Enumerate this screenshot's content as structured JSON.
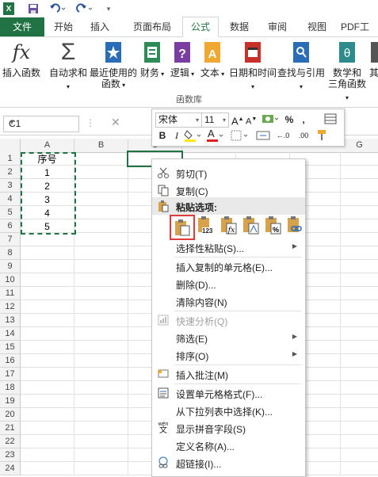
{
  "qat": {
    "app_icon": "excel-icon",
    "save_icon": "save-icon",
    "undo_icon": "undo-icon",
    "redo_icon": "redo-icon"
  },
  "tabs": [
    "文件",
    "开始",
    "插入",
    "页面布局",
    "公式",
    "数据",
    "审阅",
    "视图",
    "PDF工具"
  ],
  "ribbon": {
    "buttons": [
      {
        "label": "插入函数",
        "icon": "fx-icon"
      },
      {
        "label": "自动求和",
        "icon": "sigma-icon"
      },
      {
        "label": "最近使用的",
        "label2": "函数",
        "icon": "star-book-icon"
      },
      {
        "label": "财务",
        "icon": "finance-book-icon"
      },
      {
        "label": "逻辑",
        "icon": "logic-book-icon"
      },
      {
        "label": "文本",
        "icon": "text-book-icon"
      },
      {
        "label": "日期和时间",
        "icon": "calendar-book-icon"
      },
      {
        "label": "查找与引用",
        "icon": "lookup-book-icon"
      },
      {
        "label": "数学和",
        "label2": "三角函数",
        "icon": "math-book-icon"
      },
      {
        "label": "其",
        "icon": "more-book-icon"
      }
    ],
    "group_label": "函数库"
  },
  "namebox": {
    "value": "C1"
  },
  "columns": [
    "A",
    "B",
    "C",
    "G"
  ],
  "rows": [
    "1",
    "2",
    "3",
    "4",
    "5",
    "6",
    "7",
    "8",
    "9",
    "10",
    "11",
    "12",
    "13",
    "14",
    "15",
    "16",
    "17",
    "18",
    "19",
    "20",
    "21",
    "22",
    "23",
    "24"
  ],
  "cells": {
    "a1": "序号",
    "a2": "1",
    "a3": "2",
    "a4": "3",
    "a5": "4",
    "a6": "5"
  },
  "mini_toolbar": {
    "font": "宋体",
    "size": "11",
    "grow": "A",
    "shrink": "A",
    "percent": "%",
    "comma": ",",
    "bold": "B",
    "italic": "I",
    "font_color_letter": "A",
    "dec_inc": "←.0",
    "dec_dec": ".00"
  },
  "context_menu": {
    "cut": "剪切(T)",
    "copy": "复制(C)",
    "paste_options": "粘贴选项:",
    "paste_special": "选择性粘贴(S)...",
    "insert_copied": "插入复制的单元格(E)...",
    "delete": "删除(D)...",
    "clear": "清除内容(N)",
    "quick_analysis": "快速分析(Q)",
    "filter": "筛选(E)",
    "sort": "排序(O)",
    "insert_comment": "插入批注(M)",
    "format_cells": "设置单元格格式(F)...",
    "pick_list": "从下拉列表中选择(K)...",
    "phonetic": "显示拼音字段(S)",
    "define_name": "定义名称(A)...",
    "hyperlink": "超链接(I)...",
    "phonetic_icon_text": "wén",
    "phonetic_icon_char": "文",
    "paste_123": "123"
  },
  "colors": {
    "excel_green": "#217346",
    "selection_border": "#e03a3a"
  }
}
